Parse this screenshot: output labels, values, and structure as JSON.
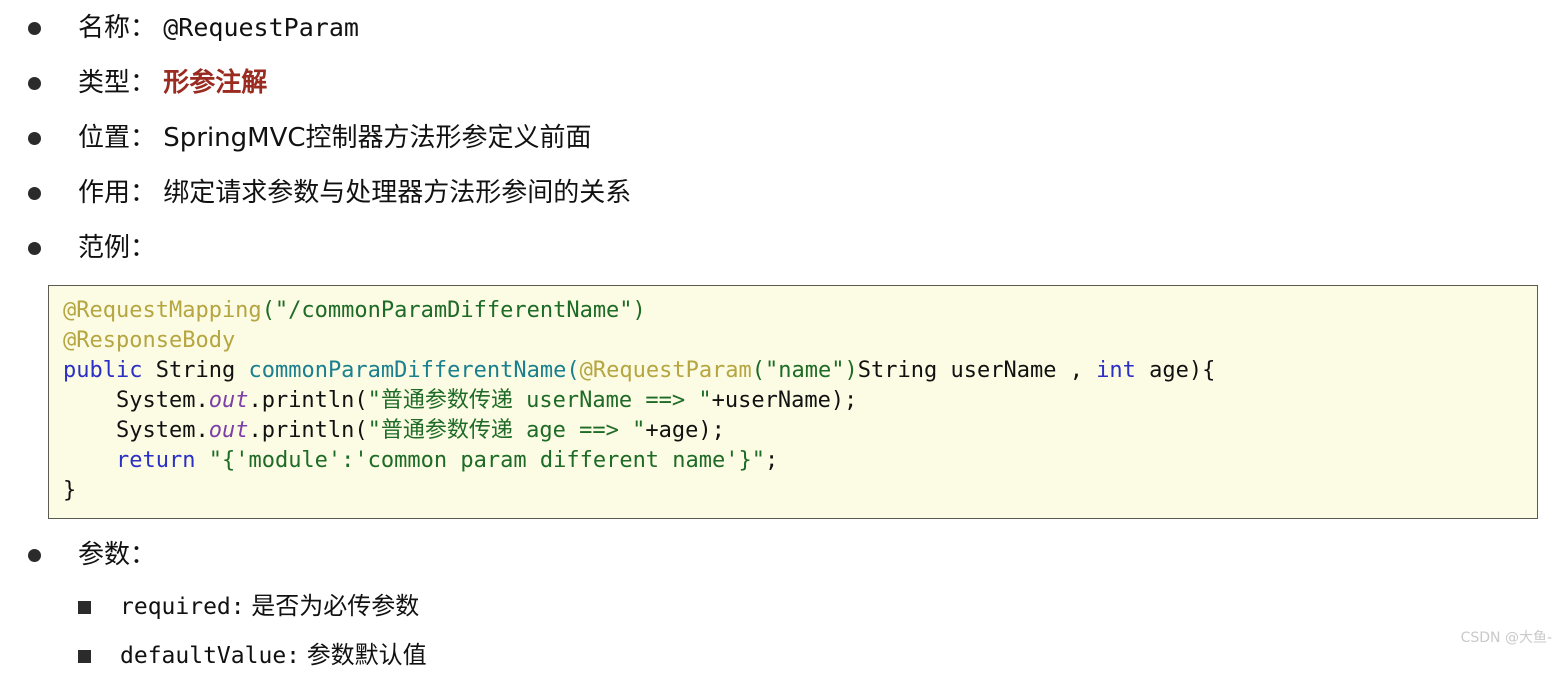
{
  "bullets": [
    {
      "label": "名称：",
      "value": "@RequestParam",
      "value_kind": "mono"
    },
    {
      "label": "类型：",
      "value": "形参注解",
      "value_kind": "red"
    },
    {
      "label": "位置：",
      "value": "SpringMVC控制器方法形参定义前面",
      "value_kind": "cjk"
    },
    {
      "label": "作用：",
      "value": "绑定请求参数与处理器方法形参间的关系",
      "value_kind": "cjk"
    },
    {
      "label": "范例：",
      "value": "",
      "value_kind": "cjk"
    }
  ],
  "code_block": {
    "background_color": "#fcfbe3",
    "border_color": "#5b5b52",
    "language": "java",
    "plain_text": "@RequestMapping(\"/commonParamDifferentName\")\n@ResponseBody\npublic String commonParamDifferentName(@RequestParam(\"name\")String userName , int age){\n    System.out.println(\"普通参数传递 userName ==> \"+userName);\n    System.out.println(\"普通参数传递 age ==> \"+age);\n    return \"{'module':'common param different name'}\";\n}",
    "lines": [
      {
        "tokens": [
          {
            "t": "@RequestMapping",
            "c": "anno"
          },
          {
            "t": "(\"/commonParamDifferentName\")",
            "c": "str"
          }
        ]
      },
      {
        "tokens": [
          {
            "t": "@ResponseBody",
            "c": "anno"
          }
        ]
      },
      {
        "tokens": [
          {
            "t": "public",
            "c": "kw"
          },
          {
            "t": " ",
            "c": "plain"
          },
          {
            "t": "String",
            "c": "type"
          },
          {
            "t": " ",
            "c": "plain"
          },
          {
            "t": "commonParamDifferentName",
            "c": "method"
          },
          {
            "t": "(",
            "c": "method"
          },
          {
            "t": "@RequestParam",
            "c": "anno"
          },
          {
            "t": "(\"name\")",
            "c": "str"
          },
          {
            "t": "String userName , ",
            "c": "plain"
          },
          {
            "t": "int",
            "c": "kw"
          },
          {
            "t": " age){",
            "c": "plain"
          }
        ]
      },
      {
        "tokens": [
          {
            "t": "    System.",
            "c": "plain"
          },
          {
            "t": "out",
            "c": "field"
          },
          {
            "t": ".println(",
            "c": "plain"
          },
          {
            "t": "\"普通参数传递 userName ==> \"",
            "c": "str"
          },
          {
            "t": "+userName);",
            "c": "plain"
          }
        ]
      },
      {
        "tokens": [
          {
            "t": "    System.",
            "c": "plain"
          },
          {
            "t": "out",
            "c": "field"
          },
          {
            "t": ".println(",
            "c": "plain"
          },
          {
            "t": "\"普通参数传递 age ==> \"",
            "c": "str"
          },
          {
            "t": "+age);",
            "c": "plain"
          }
        ]
      },
      {
        "tokens": [
          {
            "t": "    ",
            "c": "plain"
          },
          {
            "t": "return",
            "c": "kw"
          },
          {
            "t": " ",
            "c": "plain"
          },
          {
            "t": "\"{'module':'common param different name'}\"",
            "c": "str"
          },
          {
            "t": ";",
            "c": "plain"
          }
        ]
      },
      {
        "tokens": [
          {
            "t": "}",
            "c": "plain"
          }
        ]
      }
    ]
  },
  "params_section": {
    "heading": "参数：",
    "items": [
      {
        "key": "required:",
        "desc": "是否为必传参数"
      },
      {
        "key": "defaultValue:",
        "desc": "参数默认值"
      }
    ]
  },
  "watermark": "CSDN @大鱼-",
  "colors": {
    "red_emphasis": "#9a2b21",
    "annotation": "#b5a642",
    "keyword": "#2b30c4",
    "method": "#1a7f8e",
    "string": "#1d6b26",
    "field_italic": "#7c3fa8",
    "code_bg": "#fcfbe3",
    "code_border": "#5b5b52",
    "watermark": "#c9c9c9"
  }
}
